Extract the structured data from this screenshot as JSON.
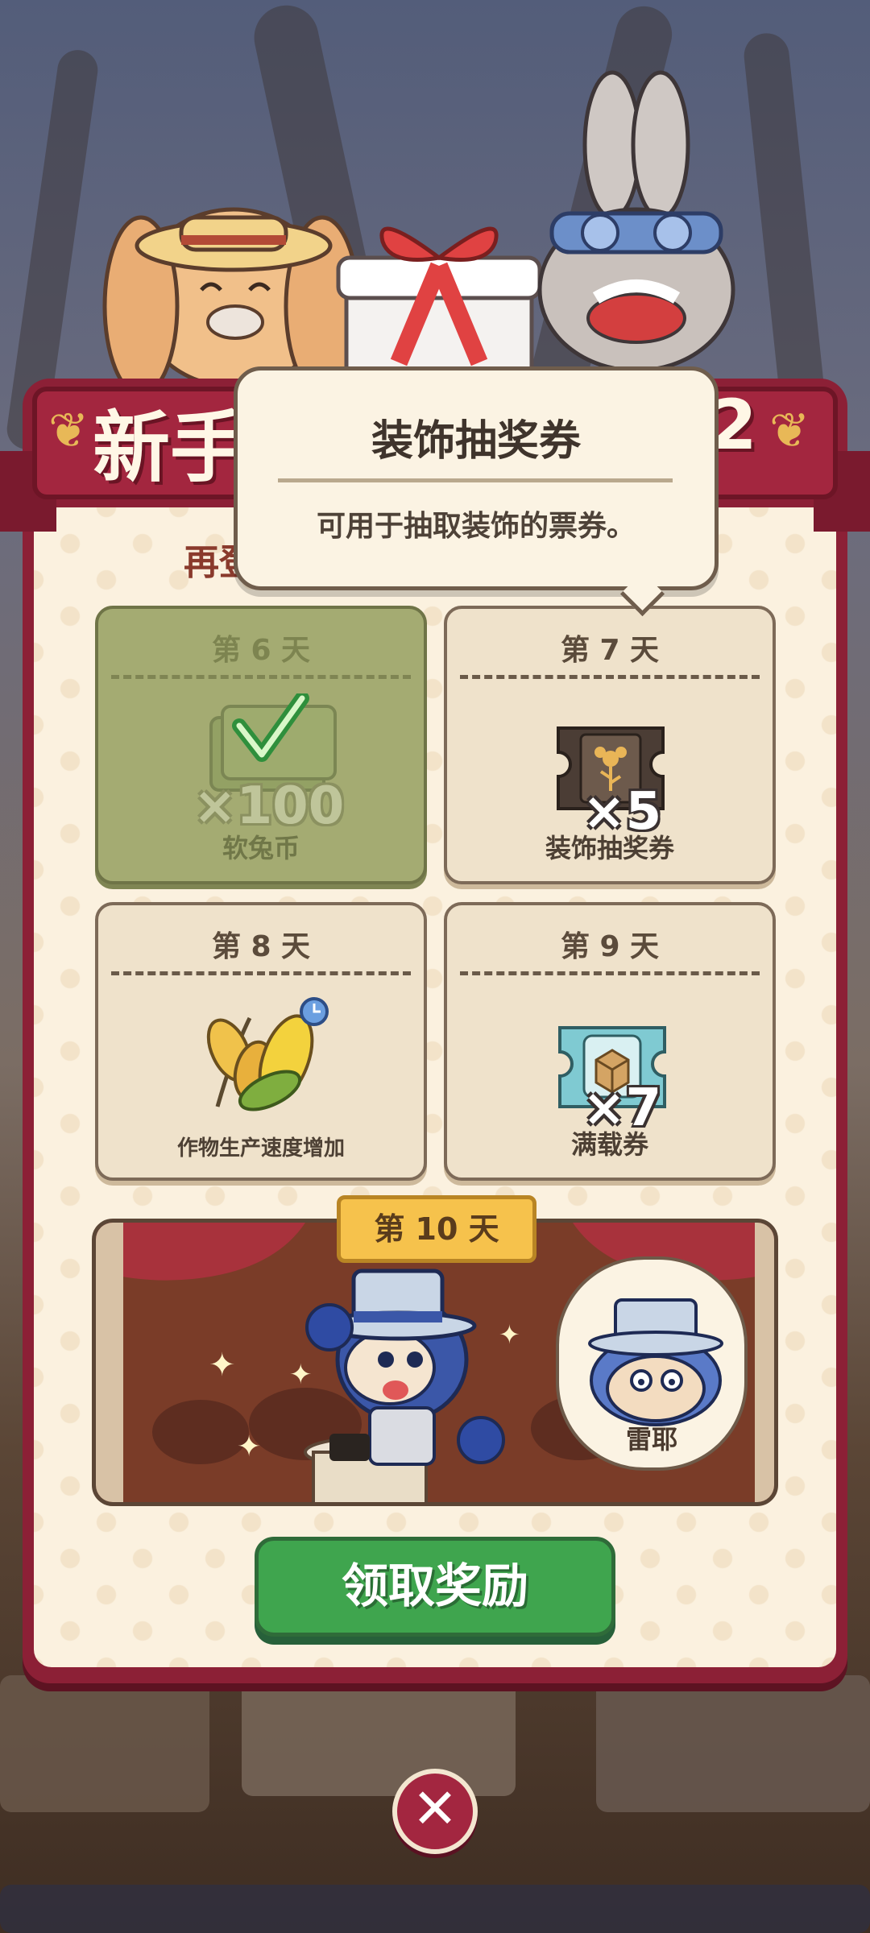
{
  "banner": {
    "title_left": "新手",
    "title_right": "2",
    "subtitle": "再登"
  },
  "tooltip": {
    "title": "装饰抽奖券",
    "description": "可用于抽取装饰的票券。"
  },
  "rewards": [
    {
      "day": "第 6 天",
      "quantity": "×100",
      "label": "软兔币",
      "icon": "coin-stack-icon",
      "status": "claimed"
    },
    {
      "day": "第 7 天",
      "quantity": "×5",
      "label": "装饰抽奖券",
      "icon": "decoration-ticket-icon",
      "status": "pending"
    },
    {
      "day": "第 8 天",
      "quantity": "",
      "label": "作物生产速度增加",
      "icon": "crop-speed-icon",
      "status": "pending"
    },
    {
      "day": "第 9 天",
      "quantity": "×7",
      "label": "满载券",
      "icon": "full-load-ticket-icon",
      "status": "pending"
    }
  ],
  "grand_reward": {
    "day": "第 10 天",
    "character_name": "雷耶"
  },
  "actions": {
    "claim_label": "领取奖励",
    "close_label": "✕"
  },
  "colors": {
    "panel": "#8c2036",
    "claim_button": "#3fa54e",
    "claimed_card": "#a4ab72"
  }
}
